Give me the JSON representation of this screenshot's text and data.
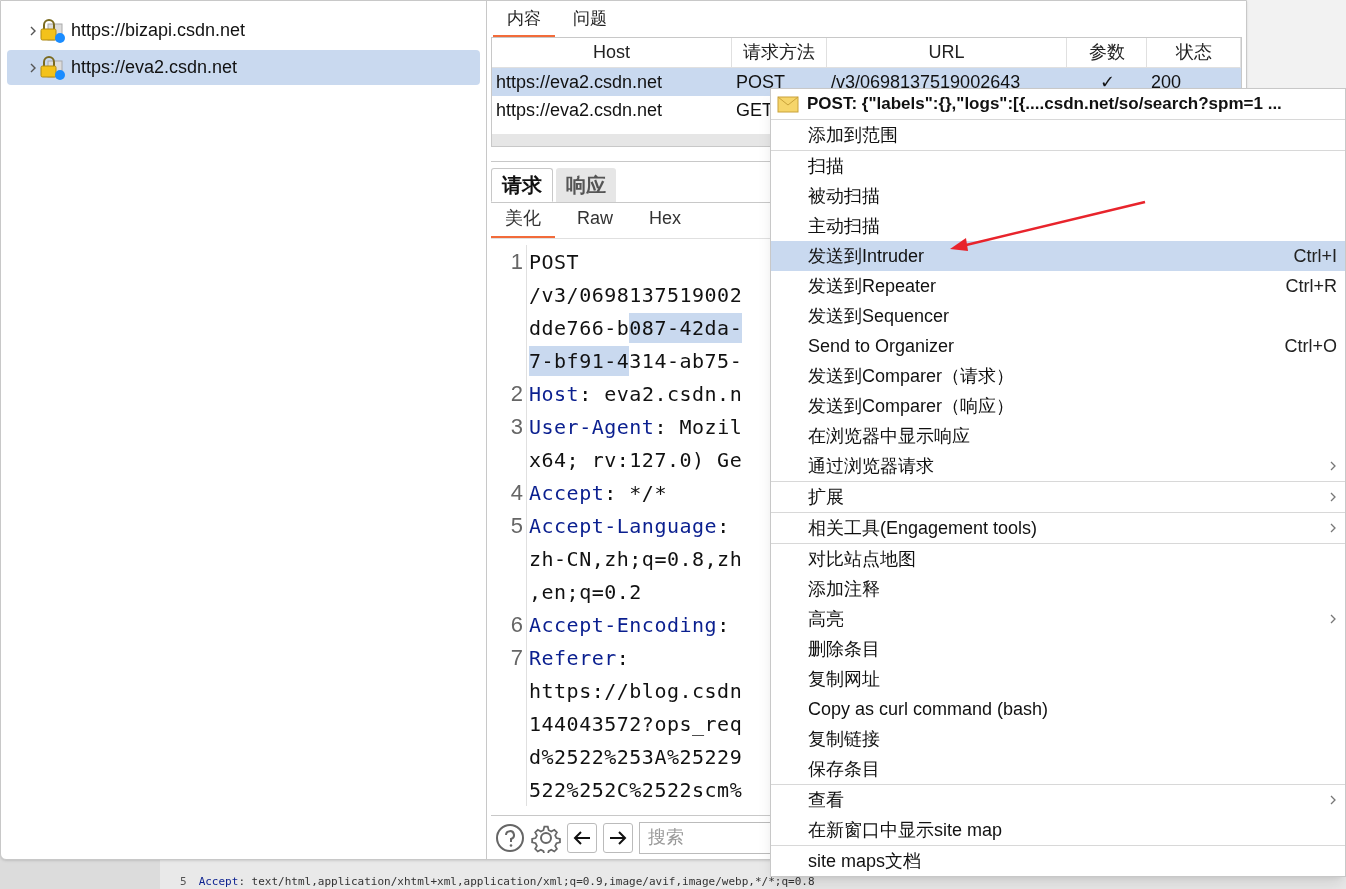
{
  "site_tree": [
    {
      "label": "https://bizapi.csdn.net",
      "selected": false
    },
    {
      "label": "https://eva2.csdn.net",
      "selected": true
    }
  ],
  "top_tabs": [
    {
      "label": "内容",
      "selected": true
    },
    {
      "label": "问题",
      "selected": false
    }
  ],
  "table": {
    "columns": [
      "Host",
      "请求方法",
      "URL",
      "参数",
      "状态"
    ],
    "rows": [
      {
        "cells": [
          "https://eva2.csdn.net",
          "POST",
          "/v3/0698137519002643",
          "✓",
          "200"
        ],
        "selected": true
      },
      {
        "cells": [
          "https://eva2.csdn.net",
          "GET"
        ],
        "selected": false
      }
    ]
  },
  "message_tabs": [
    {
      "label": "请求",
      "selected": true
    },
    {
      "label": "响应",
      "selected": false
    }
  ],
  "view_tabs": [
    {
      "label": "美化",
      "selected": true
    },
    {
      "label": "Raw",
      "selected": false
    },
    {
      "label": "Hex",
      "selected": false
    }
  ],
  "editor_lines": [
    {
      "number": "1",
      "rows": [
        [
          {
            "text": "POST",
            "kind": "plain"
          }
        ],
        [
          {
            "text": "/v3/0698137519002",
            "kind": "plain"
          }
        ],
        [
          {
            "text": "dde766-b",
            "kind": "plain"
          },
          {
            "text": "087-42da-",
            "kind": "selected"
          }
        ],
        [
          {
            "text": "7-bf91-4",
            "kind": "selected"
          },
          {
            "text": "314-ab75-",
            "kind": "plain"
          }
        ]
      ]
    },
    {
      "number": "2",
      "rows": [
        [
          {
            "text": "Host",
            "kind": "key"
          },
          {
            "text": ": eva2.csdn.n",
            "kind": "plain"
          }
        ]
      ]
    },
    {
      "number": "3",
      "rows": [
        [
          {
            "text": "User-Agent",
            "kind": "key"
          },
          {
            "text": ": Mozil",
            "kind": "plain"
          }
        ],
        [
          {
            "text": "x64; rv:127.0) Ge",
            "kind": "plain"
          }
        ]
      ]
    },
    {
      "number": "4",
      "rows": [
        [
          {
            "text": "Accept",
            "kind": "key"
          },
          {
            "text": ": */*",
            "kind": "plain"
          }
        ]
      ]
    },
    {
      "number": "5",
      "rows": [
        [
          {
            "text": "Accept-Language",
            "kind": "key"
          },
          {
            "text": ":",
            "kind": "plain"
          }
        ],
        [
          {
            "text": "zh-CN,zh;q=0.8,zh",
            "kind": "plain"
          }
        ],
        [
          {
            "text": ",en;q=0.2",
            "kind": "plain"
          }
        ]
      ]
    },
    {
      "number": "6",
      "rows": [
        [
          {
            "text": "Accept-Encoding",
            "kind": "key"
          },
          {
            "text": ":",
            "kind": "plain"
          }
        ]
      ]
    },
    {
      "number": "7",
      "rows": [
        [
          {
            "text": "Referer",
            "kind": "key"
          },
          {
            "text": ":",
            "kind": "plain"
          }
        ],
        [
          {
            "text": "https://blog.csdn",
            "kind": "plain"
          }
        ],
        [
          {
            "text": "144043572?ops_req",
            "kind": "plain"
          }
        ],
        [
          {
            "text": "d%2522%253A%25229",
            "kind": "plain"
          }
        ],
        [
          {
            "text": "522%252C%2522scm%",
            "kind": "plain"
          }
        ]
      ]
    }
  ],
  "search": {
    "placeholder": "搜索"
  },
  "context_menu": {
    "title": "POST: {\"labels\":{},\"logs\":[{....csdn.net/so/search?spm=1 ...",
    "groups": [
      [
        {
          "label": "添加到范围",
          "selected": false
        }
      ],
      [
        {
          "label": "扫描",
          "selected": false
        },
        {
          "label": "被动扫描",
          "selected": false
        },
        {
          "label": "主动扫描",
          "selected": false
        },
        {
          "label": "发送到Intruder",
          "shortcut": "Ctrl+I",
          "selected": true
        },
        {
          "label": "发送到Repeater",
          "shortcut": "Ctrl+R",
          "selected": false
        },
        {
          "label": "发送到Sequencer",
          "selected": false
        },
        {
          "label": "Send to Organizer",
          "shortcut": "Ctrl+O",
          "selected": false
        },
        {
          "label": "发送到Comparer（请求）",
          "selected": false
        },
        {
          "label": "发送到Comparer（响应）",
          "selected": false
        },
        {
          "label": "在浏览器中显示响应",
          "selected": false
        },
        {
          "label": "通过浏览器请求",
          "submenu": true,
          "selected": false
        }
      ],
      [
        {
          "label": "扩展",
          "submenu": true,
          "selected": false
        }
      ],
      [
        {
          "label": "相关工具(Engagement tools)",
          "submenu": true,
          "selected": false
        }
      ],
      [
        {
          "label": "对比站点地图",
          "selected": false
        },
        {
          "label": "添加注释",
          "selected": false
        },
        {
          "label": "高亮",
          "submenu": true,
          "selected": false
        },
        {
          "label": "删除条目",
          "selected": false
        },
        {
          "label": "复制网址",
          "selected": false
        },
        {
          "label": "Copy as curl command (bash)",
          "selected": false
        },
        {
          "label": "复制链接",
          "selected": false
        },
        {
          "label": "保存条目",
          "selected": false
        }
      ],
      [
        {
          "label": "查看",
          "submenu": true,
          "selected": false
        },
        {
          "label": "在新窗口中显示site map",
          "selected": false
        }
      ],
      [
        {
          "label": "site maps文档",
          "selected": false
        }
      ]
    ]
  },
  "background_editor": [
    {
      "number": "5",
      "key": "Accept",
      "value": ": text/html,application/xhtml+xml,application/xml;q=0.9,image/avif,image/webp,*/*;q=0.8"
    }
  ]
}
